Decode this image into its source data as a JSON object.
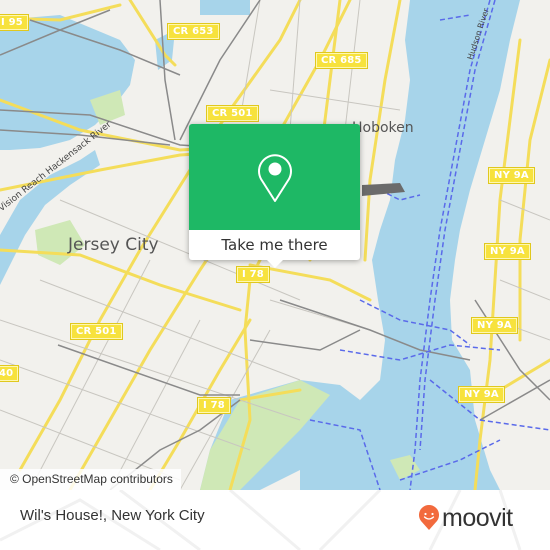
{
  "map": {
    "road_shields": [
      {
        "label": "I 95"
      },
      {
        "label": "CR 653"
      },
      {
        "label": "CR 685"
      },
      {
        "label": "CR 501"
      },
      {
        "label": "NY 9A"
      },
      {
        "label": "NY 9A"
      },
      {
        "label": "NY 9A"
      },
      {
        "label": "NY 9A"
      },
      {
        "label": "I 78"
      },
      {
        "label": "CR 501"
      },
      {
        "label": "I 78"
      },
      {
        "label": "40"
      }
    ],
    "places": {
      "jersey_city": "Jersey City",
      "hoboken": "Hoboken"
    },
    "rivers": {
      "hackensack": "Vision Reach Hackensack River",
      "hudson": "Hudson River"
    },
    "attribution": "© OpenStreetMap contributors"
  },
  "popup": {
    "icon": "map-pin-icon",
    "cta_label": "Take me there",
    "accent_color": "#1eb865"
  },
  "footer": {
    "location_title": "Wil's House!, New York City",
    "brand": {
      "name": "moovit",
      "icon": "moovit-smiley-pin-icon",
      "color": "#f26a3d"
    }
  }
}
